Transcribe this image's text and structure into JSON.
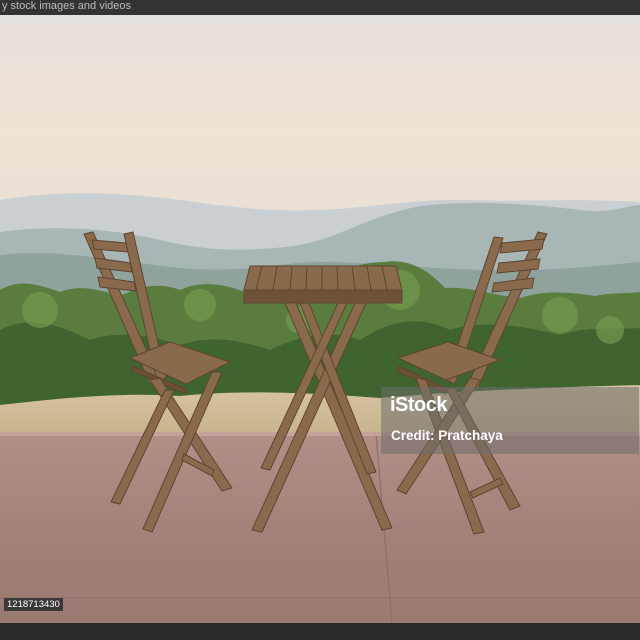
{
  "header": {
    "text": "y stock images and videos"
  },
  "watermark": {
    "logo": "iStock",
    "credit": "Credit: Pratchaya"
  },
  "image_id": "1218713430",
  "scene": {
    "subject": "two wooden folding chairs and table on a terrace overlooking misty hills"
  }
}
